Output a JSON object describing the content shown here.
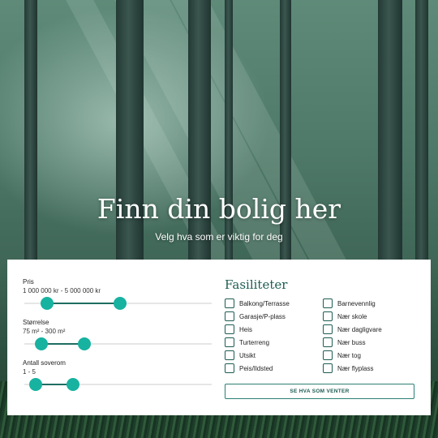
{
  "hero": {
    "title": "Finn din bolig her",
    "subtitle": "Velg hva som er viktig for deg"
  },
  "filters": [
    {
      "label": "Pris",
      "range_text": "1 000 000 kr - 5 000 000 kr",
      "min_fraction": 0.12,
      "max_fraction": 0.51
    },
    {
      "label": "Størrelse",
      "range_text": "75 m² - 300 m²",
      "min_fraction": 0.09,
      "max_fraction": 0.32
    },
    {
      "label": "Antall soverom",
      "range_text": "1 - 5",
      "min_fraction": 0.06,
      "max_fraction": 0.26
    }
  ],
  "amenities": {
    "title": "Fasiliteter",
    "column1": [
      "Balkong/Terrasse",
      "Garasje/P-plass",
      "Heis",
      "Turterreng",
      "Utsikt",
      "Peis/Ildsted"
    ],
    "column2": [
      "Barnevennlig",
      "Nær skole",
      "Nær dagligvare",
      "Nær buss",
      "Nær tog",
      "Nær flyplass"
    ]
  },
  "cta_label": "SE HVA SOM VENTER",
  "colors": {
    "accent": "#17b2a0",
    "dark_teal": "#1d5c52"
  }
}
